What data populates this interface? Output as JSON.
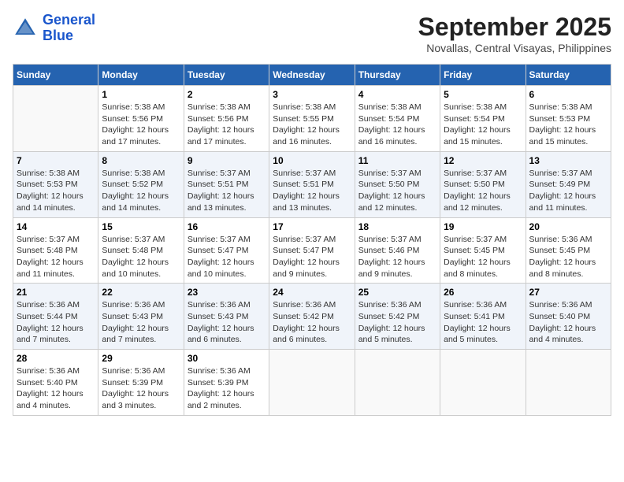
{
  "header": {
    "logo_line1": "General",
    "logo_line2": "Blue",
    "month": "September 2025",
    "location": "Novallas, Central Visayas, Philippines"
  },
  "weekdays": [
    "Sunday",
    "Monday",
    "Tuesday",
    "Wednesday",
    "Thursday",
    "Friday",
    "Saturday"
  ],
  "weeks": [
    [
      {
        "day": "",
        "info": ""
      },
      {
        "day": "1",
        "info": "Sunrise: 5:38 AM\nSunset: 5:56 PM\nDaylight: 12 hours\nand 17 minutes."
      },
      {
        "day": "2",
        "info": "Sunrise: 5:38 AM\nSunset: 5:56 PM\nDaylight: 12 hours\nand 17 minutes."
      },
      {
        "day": "3",
        "info": "Sunrise: 5:38 AM\nSunset: 5:55 PM\nDaylight: 12 hours\nand 16 minutes."
      },
      {
        "day": "4",
        "info": "Sunrise: 5:38 AM\nSunset: 5:54 PM\nDaylight: 12 hours\nand 16 minutes."
      },
      {
        "day": "5",
        "info": "Sunrise: 5:38 AM\nSunset: 5:54 PM\nDaylight: 12 hours\nand 15 minutes."
      },
      {
        "day": "6",
        "info": "Sunrise: 5:38 AM\nSunset: 5:53 PM\nDaylight: 12 hours\nand 15 minutes."
      }
    ],
    [
      {
        "day": "7",
        "info": "Sunrise: 5:38 AM\nSunset: 5:53 PM\nDaylight: 12 hours\nand 14 minutes."
      },
      {
        "day": "8",
        "info": "Sunrise: 5:38 AM\nSunset: 5:52 PM\nDaylight: 12 hours\nand 14 minutes."
      },
      {
        "day": "9",
        "info": "Sunrise: 5:37 AM\nSunset: 5:51 PM\nDaylight: 12 hours\nand 13 minutes."
      },
      {
        "day": "10",
        "info": "Sunrise: 5:37 AM\nSunset: 5:51 PM\nDaylight: 12 hours\nand 13 minutes."
      },
      {
        "day": "11",
        "info": "Sunrise: 5:37 AM\nSunset: 5:50 PM\nDaylight: 12 hours\nand 12 minutes."
      },
      {
        "day": "12",
        "info": "Sunrise: 5:37 AM\nSunset: 5:50 PM\nDaylight: 12 hours\nand 12 minutes."
      },
      {
        "day": "13",
        "info": "Sunrise: 5:37 AM\nSunset: 5:49 PM\nDaylight: 12 hours\nand 11 minutes."
      }
    ],
    [
      {
        "day": "14",
        "info": "Sunrise: 5:37 AM\nSunset: 5:48 PM\nDaylight: 12 hours\nand 11 minutes."
      },
      {
        "day": "15",
        "info": "Sunrise: 5:37 AM\nSunset: 5:48 PM\nDaylight: 12 hours\nand 10 minutes."
      },
      {
        "day": "16",
        "info": "Sunrise: 5:37 AM\nSunset: 5:47 PM\nDaylight: 12 hours\nand 10 minutes."
      },
      {
        "day": "17",
        "info": "Sunrise: 5:37 AM\nSunset: 5:47 PM\nDaylight: 12 hours\nand 9 minutes."
      },
      {
        "day": "18",
        "info": "Sunrise: 5:37 AM\nSunset: 5:46 PM\nDaylight: 12 hours\nand 9 minutes."
      },
      {
        "day": "19",
        "info": "Sunrise: 5:37 AM\nSunset: 5:45 PM\nDaylight: 12 hours\nand 8 minutes."
      },
      {
        "day": "20",
        "info": "Sunrise: 5:36 AM\nSunset: 5:45 PM\nDaylight: 12 hours\nand 8 minutes."
      }
    ],
    [
      {
        "day": "21",
        "info": "Sunrise: 5:36 AM\nSunset: 5:44 PM\nDaylight: 12 hours\nand 7 minutes."
      },
      {
        "day": "22",
        "info": "Sunrise: 5:36 AM\nSunset: 5:43 PM\nDaylight: 12 hours\nand 7 minutes."
      },
      {
        "day": "23",
        "info": "Sunrise: 5:36 AM\nSunset: 5:43 PM\nDaylight: 12 hours\nand 6 minutes."
      },
      {
        "day": "24",
        "info": "Sunrise: 5:36 AM\nSunset: 5:42 PM\nDaylight: 12 hours\nand 6 minutes."
      },
      {
        "day": "25",
        "info": "Sunrise: 5:36 AM\nSunset: 5:42 PM\nDaylight: 12 hours\nand 5 minutes."
      },
      {
        "day": "26",
        "info": "Sunrise: 5:36 AM\nSunset: 5:41 PM\nDaylight: 12 hours\nand 5 minutes."
      },
      {
        "day": "27",
        "info": "Sunrise: 5:36 AM\nSunset: 5:40 PM\nDaylight: 12 hours\nand 4 minutes."
      }
    ],
    [
      {
        "day": "28",
        "info": "Sunrise: 5:36 AM\nSunset: 5:40 PM\nDaylight: 12 hours\nand 4 minutes."
      },
      {
        "day": "29",
        "info": "Sunrise: 5:36 AM\nSunset: 5:39 PM\nDaylight: 12 hours\nand 3 minutes."
      },
      {
        "day": "30",
        "info": "Sunrise: 5:36 AM\nSunset: 5:39 PM\nDaylight: 12 hours\nand 2 minutes."
      },
      {
        "day": "",
        "info": ""
      },
      {
        "day": "",
        "info": ""
      },
      {
        "day": "",
        "info": ""
      },
      {
        "day": "",
        "info": ""
      }
    ]
  ]
}
